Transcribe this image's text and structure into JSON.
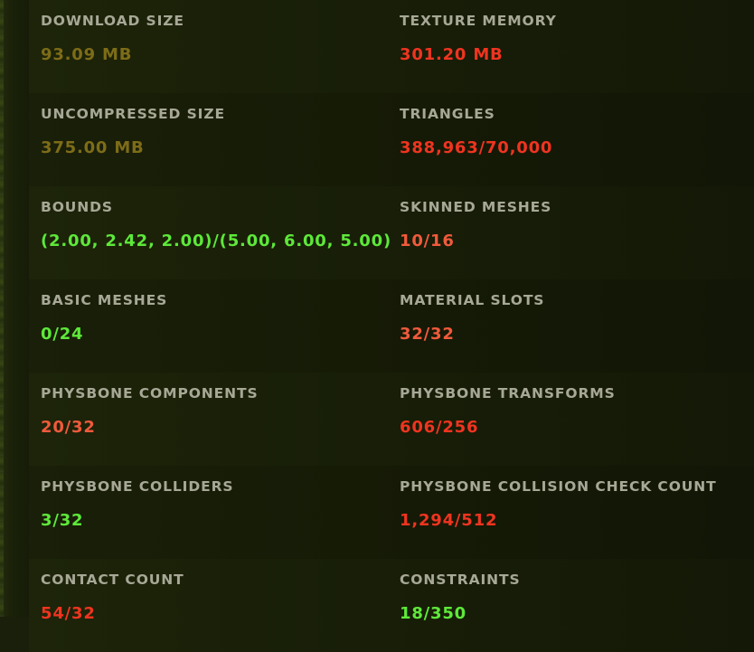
{
  "stats": [
    {
      "left": {
        "label": "DOWNLOAD SIZE",
        "value": "93.09 MB",
        "status": "olive"
      },
      "right": {
        "label": "TEXTURE MEMORY",
        "value": "301.20 MB",
        "status": "red"
      }
    },
    {
      "left": {
        "label": "UNCOMPRESSED SIZE",
        "value": "375.00 MB",
        "status": "olive"
      },
      "right": {
        "label": "TRIANGLES",
        "value": "388,963/70,000",
        "status": "red"
      }
    },
    {
      "left": {
        "label": "BOUNDS",
        "value": "(2.00, 2.42, 2.00)/(5.00, 6.00, 5.00)",
        "status": "green"
      },
      "right": {
        "label": "SKINNED MESHES",
        "value": "10/16",
        "status": "orange"
      }
    },
    {
      "left": {
        "label": "BASIC MESHES",
        "value": "0/24",
        "status": "green"
      },
      "right": {
        "label": "MATERIAL SLOTS",
        "value": "32/32",
        "status": "orange"
      }
    },
    {
      "left": {
        "label": "PHYSBONE COMPONENTS",
        "value": "20/32",
        "status": "orange"
      },
      "right": {
        "label": "PHYSBONE TRANSFORMS",
        "value": "606/256",
        "status": "red"
      }
    },
    {
      "left": {
        "label": "PHYSBONE COLLIDERS",
        "value": "3/32",
        "status": "green"
      },
      "right": {
        "label": "PHYSBONE COLLISION CHECK COUNT",
        "value": "1,294/512",
        "status": "red"
      }
    },
    {
      "left": {
        "label": "CONTACT COUNT",
        "value": "54/32",
        "status": "red"
      },
      "right": {
        "label": "CONSTRAINTS",
        "value": "18/350",
        "status": "green"
      }
    }
  ],
  "colors": {
    "olive": "#7d6c18",
    "red": "#ef3420",
    "orange": "#f05a3c",
    "green": "#5ee83a",
    "label": "#a7a896",
    "background": "#161b08"
  }
}
